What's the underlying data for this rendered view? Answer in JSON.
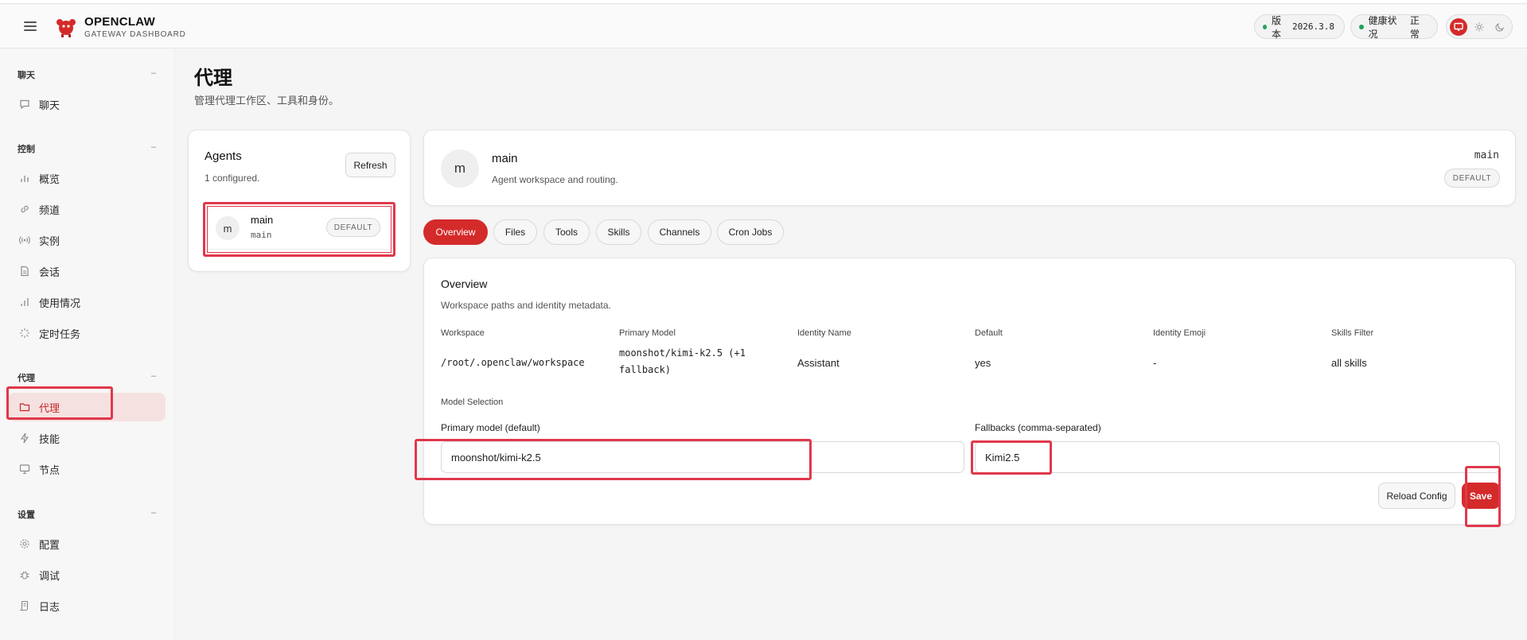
{
  "brand": {
    "title": "OPENCLAW",
    "subtitle": "GATEWAY DASHBOARD"
  },
  "status": {
    "version_label": "版本",
    "version_value": "2026.3.8",
    "health_label": "健康状况",
    "health_value": "正常",
    "indicator_color": "#22a45a"
  },
  "theme_icons": [
    "monitor-icon",
    "sun-icon",
    "moon-icon"
  ],
  "sidebar": {
    "groups": [
      {
        "label": "聊天",
        "items": [
          "聊天"
        ]
      },
      {
        "label": "控制",
        "items": [
          "概览",
          "频道",
          "实例",
          "会话",
          "使用情况",
          "定时任务"
        ]
      },
      {
        "label": "代理",
        "items": [
          "代理",
          "技能",
          "节点"
        ]
      },
      {
        "label": "设置",
        "items": [
          "配置",
          "调试",
          "日志"
        ]
      }
    ],
    "collapse_glyph": "–",
    "active_item": "代理"
  },
  "page": {
    "title": "代理",
    "subtitle": "管理代理工作区、工具和身份。"
  },
  "agents_panel": {
    "title": "Agents",
    "count_text": "1 configured.",
    "refresh_label": "Refresh",
    "agent": {
      "avatar": "m",
      "name": "main",
      "id": "main",
      "badge": "DEFAULT"
    }
  },
  "agent_header": {
    "avatar": "m",
    "name": "main",
    "description": "Agent workspace and routing.",
    "id": "main",
    "badge": "DEFAULT"
  },
  "tabs": [
    "Overview",
    "Files",
    "Tools",
    "Skills",
    "Channels",
    "Cron Jobs"
  ],
  "active_tab": "Overview",
  "overview": {
    "title": "Overview",
    "subtitle": "Workspace paths and identity metadata.",
    "fields": {
      "workspace": {
        "label": "Workspace",
        "value": "/root/.openclaw/workspace"
      },
      "primary_model": {
        "label": "Primary Model",
        "value_line1": "moonshot/kimi-k2.5 (+1",
        "value_line2": "fallback)"
      },
      "identity_name": {
        "label": "Identity Name",
        "value": "Assistant"
      },
      "default": {
        "label": "Default",
        "value": "yes"
      },
      "identity_emoji": {
        "label": "Identity Emoji",
        "value": "-"
      },
      "skills_filter": {
        "label": "Skills Filter",
        "value": "all skills"
      }
    },
    "model_selection": {
      "section_label": "Model Selection",
      "primary_label": "Primary model (default)",
      "primary_value": "moonshot/kimi-k2.5",
      "fallbacks_label": "Fallbacks (comma-separated)",
      "fallbacks_value": "Kimi2.5"
    },
    "reload_label": "Reload Config",
    "save_label": "Save"
  },
  "colors": {
    "accent": "#d42a2a",
    "highlight": "#e0384b",
    "active_bg": "#f6e1e1"
  }
}
